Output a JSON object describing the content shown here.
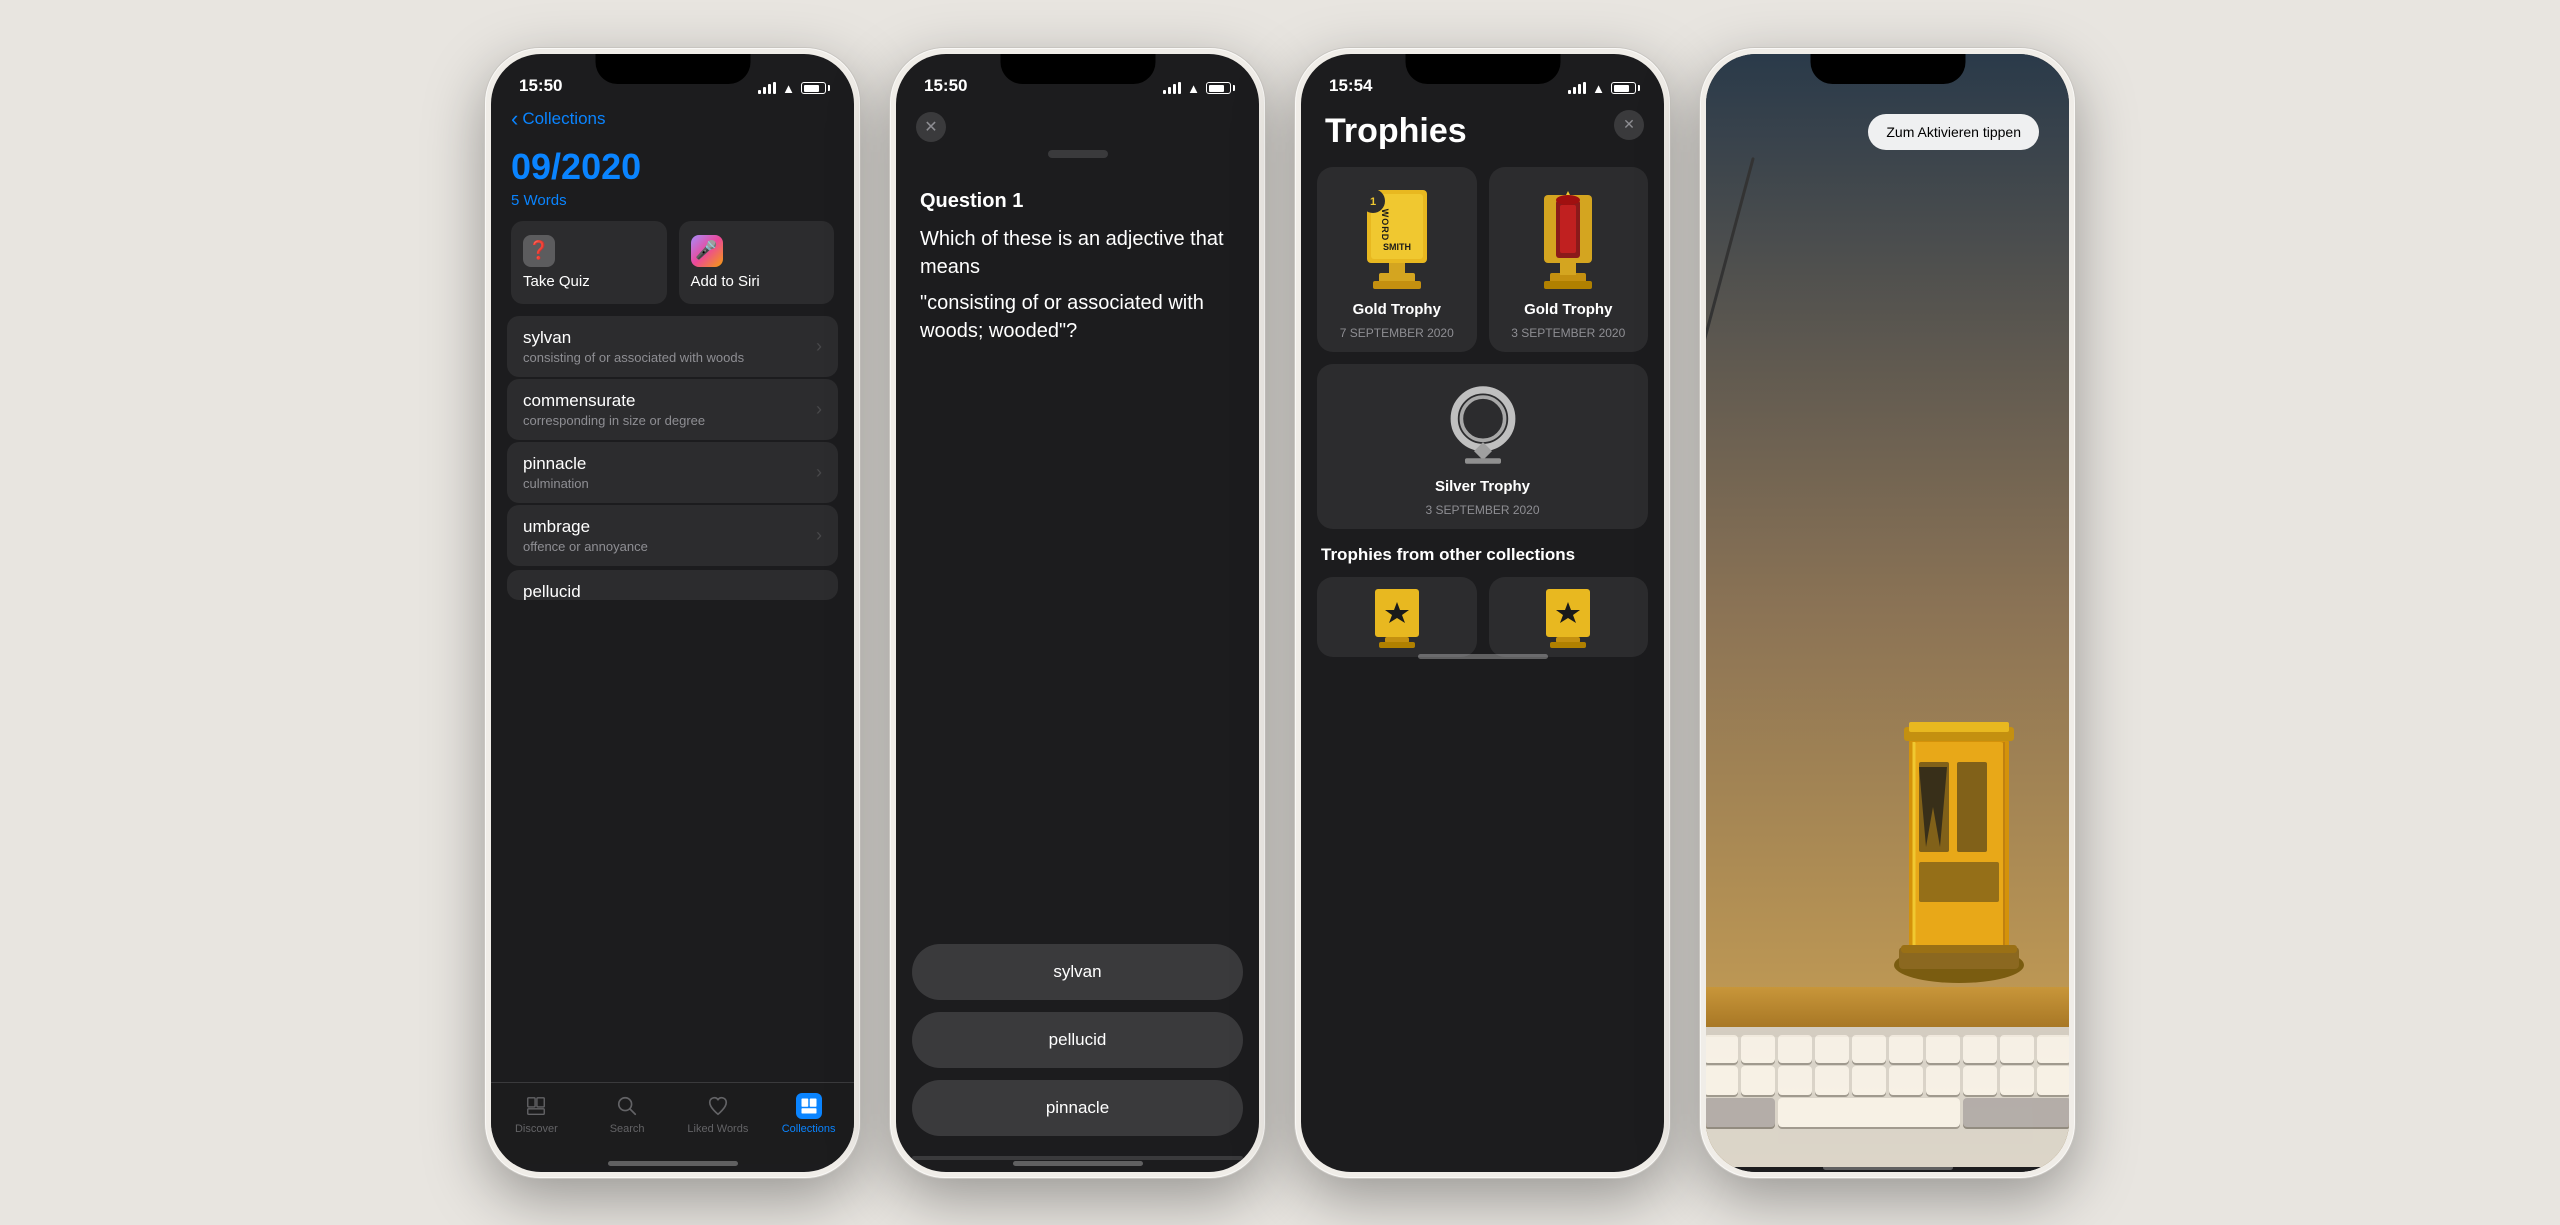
{
  "phones": [
    {
      "id": "phone1",
      "status_time": "15:50",
      "nav_back": "Collections",
      "title": "09/2020",
      "subtitle": "5 Words",
      "buttons": [
        {
          "icon": "❓",
          "label": "Take Quiz",
          "icon_style": "quiz"
        },
        {
          "icon": "🎤",
          "label": "Add to Siri",
          "icon_style": "siri"
        }
      ],
      "words": [
        {
          "name": "sylvan",
          "def": "consisting of or associated with woods"
        },
        {
          "name": "commensurate",
          "def": "corresponding in size or degree"
        },
        {
          "name": "pinnacle",
          "def": "culmination"
        },
        {
          "name": "umbrage",
          "def": "offence or annoyance"
        }
      ],
      "partial_word": "pellucid",
      "tabs": [
        {
          "id": "discover",
          "label": "Discover",
          "icon": "📄",
          "active": false
        },
        {
          "id": "search",
          "label": "Search",
          "icon": "🔍",
          "active": false
        },
        {
          "id": "liked",
          "label": "Liked Words",
          "icon": "🤍",
          "active": false
        },
        {
          "id": "collections",
          "label": "Collections",
          "icon": "📋",
          "active": true
        }
      ]
    },
    {
      "id": "phone2",
      "status_time": "15:50",
      "question_label": "Question 1",
      "question_text": "Which of these is an adjective that means",
      "question_quote": "\"consisting of or associated with woods; wooded\"?",
      "answers": [
        "sylvan",
        "pellucid",
        "pinnacle"
      ]
    },
    {
      "id": "phone3",
      "status_time": "15:54",
      "title": "Trophies",
      "trophies": [
        {
          "name": "Gold Trophy",
          "date": "7 SEPTEMBER 2020",
          "type": "gold",
          "number": "1"
        },
        {
          "name": "Gold Trophy",
          "date": "3 SEPTEMBER 2020",
          "type": "gold",
          "number": ""
        }
      ],
      "silver_trophy": {
        "name": "Silver Trophy",
        "date": "3 SEPTEMBER 2020",
        "type": "silver"
      },
      "section_other": "Trophies from other collections"
    },
    {
      "id": "phone4",
      "tooltip": "Zum Aktivieren tippen"
    }
  ]
}
